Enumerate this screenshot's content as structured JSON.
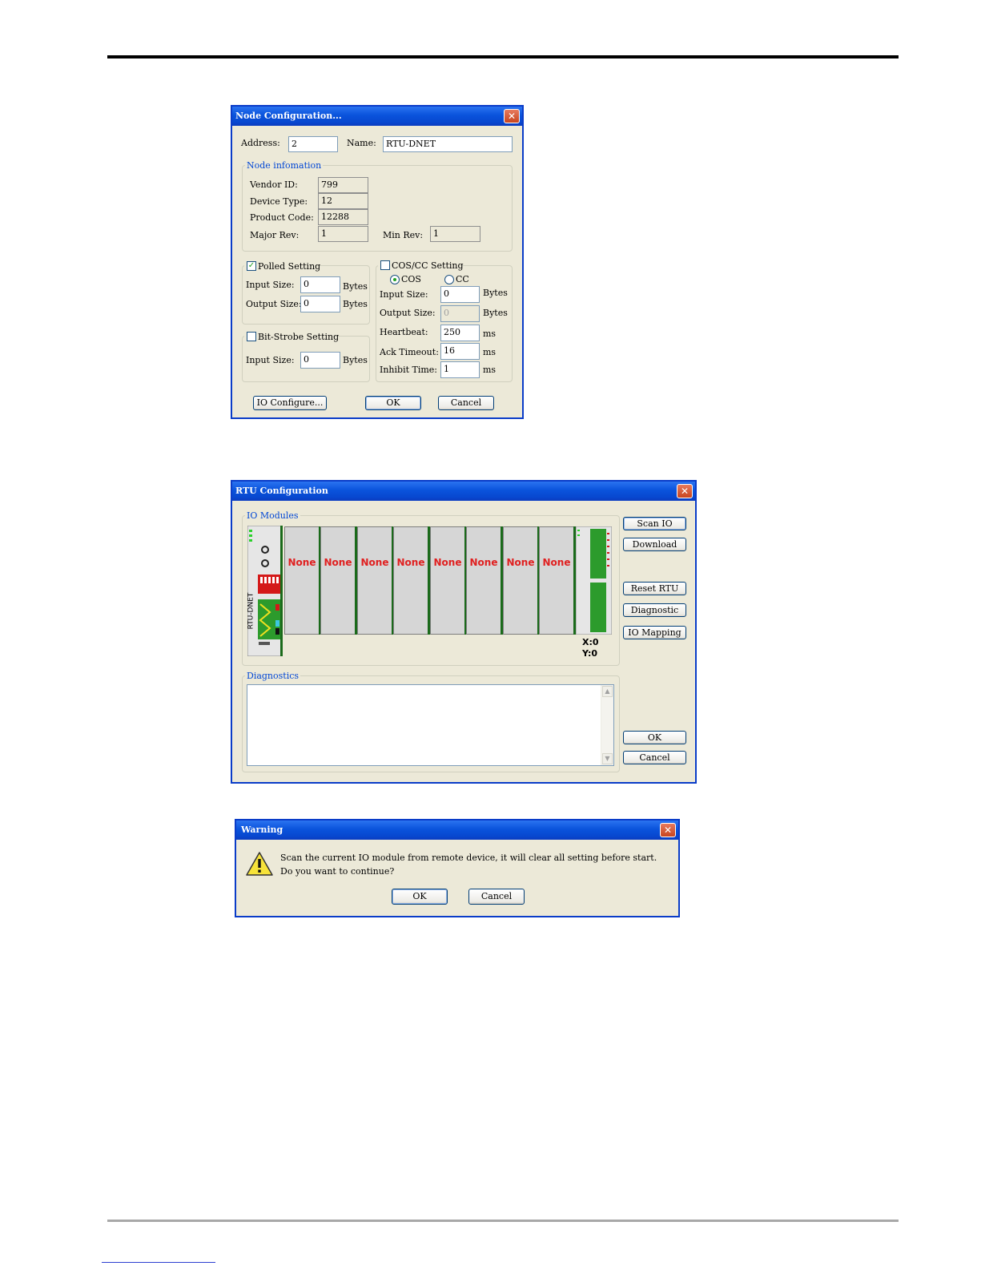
{
  "node_dialog": {
    "title": "Node Configuration...",
    "address_label": "Address:",
    "address_value": "2",
    "name_label": "Name:",
    "name_value": "RTU-DNET",
    "node_info": {
      "group_title": "Node infomation",
      "vendor_id_label": "Vendor ID:",
      "vendor_id": "799",
      "device_type_label": "Device Type:",
      "device_type": "12",
      "product_code_label": "Product Code:",
      "product_code": "12288",
      "major_rev_label": "Major Rev:",
      "major_rev": "1",
      "min_rev_label": "Min Rev:",
      "min_rev": "1"
    },
    "polled": {
      "label": "Polled Setting",
      "checked": true,
      "input_size_label": "Input Size:",
      "input_size": "0",
      "output_size_label": "Output Size:",
      "output_size": "0",
      "unit": "Bytes"
    },
    "bit_strobe": {
      "label": "Bit-Strobe Setting",
      "checked": false,
      "input_size_label": "Input Size:",
      "input_size": "0",
      "unit": "Bytes"
    },
    "cos_cc": {
      "label": "COS/CC Setting",
      "checked": false,
      "cos_label": "COS",
      "cc_label": "CC",
      "selected": "COS",
      "input_size_label": "Input Size:",
      "input_size": "0",
      "output_size_label": "Output Size:",
      "output_size": "0",
      "heartbeat_label": "Heartbeat:",
      "heartbeat": "250",
      "ack_timeout_label": "Ack Timeout:",
      "ack_timeout": "16",
      "inhibit_time_label": "Inhibit Time:",
      "inhibit_time": "1",
      "bytes_unit": "Bytes",
      "ms_unit": "ms"
    },
    "buttons": {
      "io_configure": "IO Configure...",
      "ok": "OK",
      "cancel": "Cancel"
    }
  },
  "rtu_dialog": {
    "title": "RTU Configuration",
    "io_modules_title": "IO Modules",
    "rtu_label": "RTU-DNET",
    "slots": [
      "None",
      "None",
      "None",
      "None",
      "None",
      "None",
      "None",
      "None"
    ],
    "x_count": "X:0",
    "y_count": "Y:0",
    "diagnostics_title": "Diagnostics",
    "buttons": {
      "scan_io": "Scan IO",
      "download": "Download",
      "reset_rtu": "Reset RTU",
      "diagnostic": "Diagnostic",
      "io_mapping": "IO Mapping",
      "ok": "OK",
      "cancel": "Cancel"
    }
  },
  "warning_dialog": {
    "title": "Warning",
    "message_line1": "Scan the current IO module from remote device, it will clear all setting before start.",
    "message_line2": "Do you want to continue?",
    "ok": "OK",
    "cancel": "Cancel"
  }
}
